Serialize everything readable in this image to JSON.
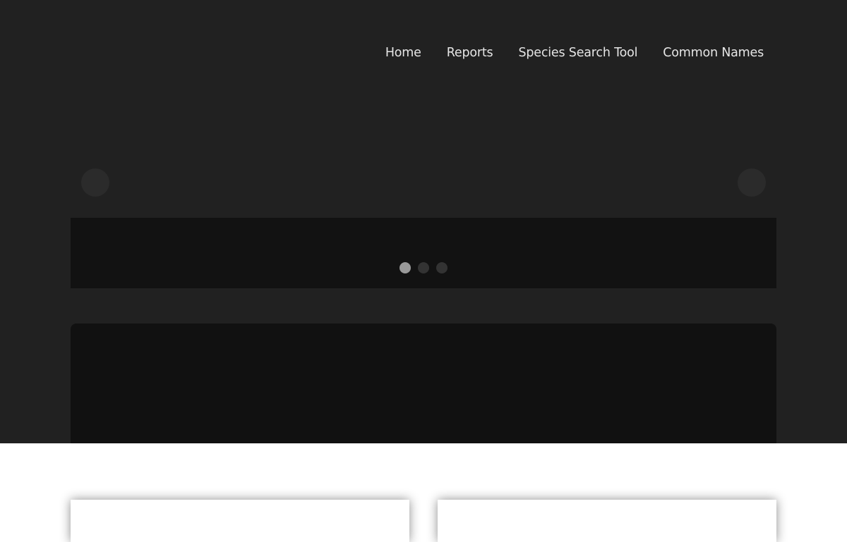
{
  "nav": {
    "items": [
      {
        "label": "Home"
      },
      {
        "label": "Reports"
      },
      {
        "label": "Species Search Tool"
      },
      {
        "label": "Common Names"
      }
    ]
  },
  "carousel": {
    "slide_count": 3,
    "active_index": 0
  },
  "colors": {
    "hero_bg": "#212121",
    "band_bg": "#121212",
    "panel_bg": "#111111",
    "dot_active": "#999999",
    "dot_inactive": "#333333",
    "nav_text": "#e6e6e6"
  }
}
